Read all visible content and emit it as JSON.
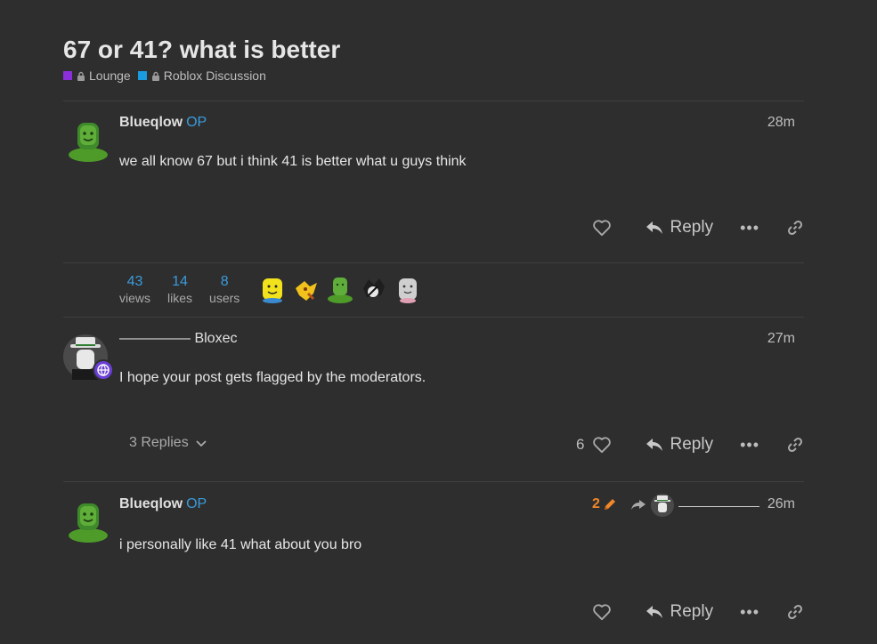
{
  "topic": {
    "title": "67 or 41? what is better",
    "categories": [
      {
        "name": "Lounge",
        "color": "#8b2fdb"
      },
      {
        "name": "Roblox Discussion",
        "color": "#1a9be0"
      }
    ]
  },
  "posts": [
    {
      "username": "Blueqlow",
      "op_badge": "OP",
      "time": "28m",
      "text": "we all know 67 but i think 41 is better what u guys think",
      "reply_label": "Reply"
    },
    {
      "username_prefix": "—————",
      "username": "Bloxec",
      "time": "27m",
      "text": "I hope your post gets flagged by the moderators.",
      "replies_label": "3 Replies",
      "likes": "6",
      "reply_label": "Reply"
    },
    {
      "username": "Blueqlow",
      "op_badge": "OP",
      "time": "26m",
      "text": "i personally like 41 what about you bro",
      "edit_count": "2",
      "reply_to_name": "———————",
      "reply_label": "Reply"
    }
  ],
  "stats": [
    {
      "value": "43",
      "label": "views"
    },
    {
      "value": "14",
      "label": "likes"
    },
    {
      "value": "8",
      "label": "users"
    }
  ],
  "colors": {
    "accent": "#3a9bdc",
    "edit": "#f0872a",
    "background": "#2e2e2e"
  }
}
